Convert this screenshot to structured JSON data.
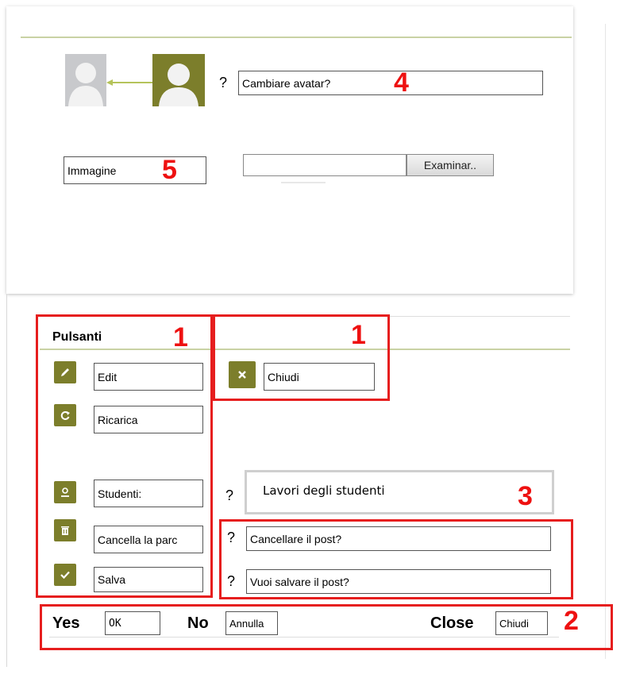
{
  "avatar_section": {
    "question_mark": "?",
    "change_avatar_field": "Cambiare avatar?",
    "badge_4": "4",
    "image_field": "Immagine",
    "badge_5": "5",
    "file_path_value": "",
    "browse_button": "Examinar.."
  },
  "buttons_panel": {
    "title": "Pulsanti",
    "badge_1_left": "1",
    "badge_1_right": "1",
    "items": [
      {
        "icon": "pencil-icon",
        "label": "Edit"
      },
      {
        "icon": "refresh-icon",
        "label": "Ricarica"
      },
      {
        "icon": "user-icon",
        "label": "Studenti:"
      },
      {
        "icon": "trash-icon",
        "label": "Cancella la parc"
      },
      {
        "icon": "check-icon",
        "label": "Salva"
      }
    ],
    "close_item": {
      "icon": "close-icon",
      "label": "Chiudi"
    }
  },
  "questions": {
    "student_works_q": "?",
    "student_works": "Lavori degli studenti",
    "badge_3": "3",
    "delete_post_q": "?",
    "delete_post": "Cancellare il post?",
    "save_post_q": "?",
    "save_post": "Vuoi salvare il post?",
    "badge_2": "2"
  },
  "dialog_bar": {
    "yes_label": "Yes",
    "yes_value": "OK",
    "no_label": "No",
    "no_value": "Annulla",
    "close_label": "Close",
    "close_value": "Chiudi",
    "badge_2": "2"
  },
  "colors": {
    "accent_olive": "#7c7e2b",
    "annotation_red": "#e61e1e",
    "divider_green": "#c9d2a4"
  }
}
